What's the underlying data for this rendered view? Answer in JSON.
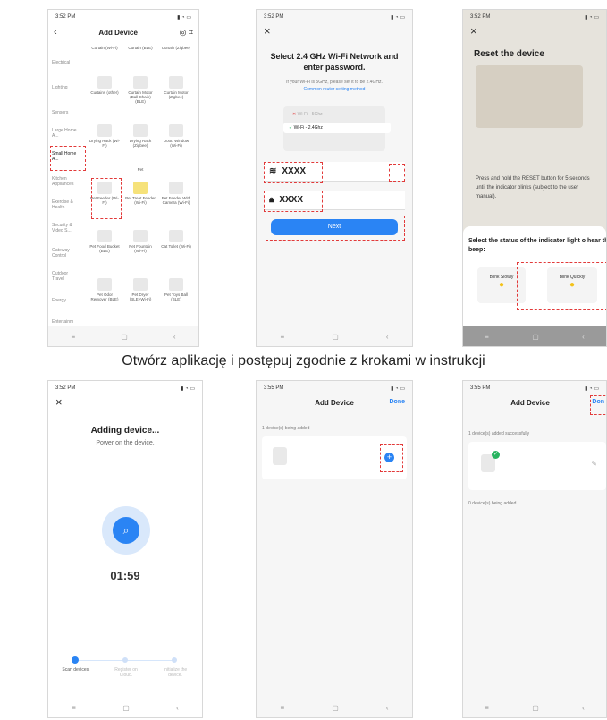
{
  "caption": "Otwórz aplikację i postępuj zgodnie z krokami w instrukcji",
  "screen1": {
    "time": "3:52 PM",
    "title": "Add Device",
    "categories": [
      "Electrical",
      "Lighting",
      "Sensors",
      "Large Home A...",
      "Small Home A...",
      "Kitchen Appliances",
      "Exercise & Health",
      "Security & Video S...",
      "Gateway Control",
      "Outdoor Travel",
      "Energy",
      "Entertainm"
    ],
    "devices_top": [
      "Curtain (Wi-Fi)",
      "Curtain (BLE)",
      "Curtain (Zigbee)",
      "Curtains (other)",
      "Curtain Motor (Ball Chain) (BLE)",
      "Curtain Motor (Zigbee)"
    ],
    "devices_mid": [
      "Drying Rack (Wi-Fi)",
      "Drying Rack (Zigbee)",
      "Door/ Window (Wi-Fi)"
    ],
    "pet_label": "Pet",
    "devices_pet": [
      "Pet Feeder (Wi-Fi)",
      "Pet Treat Feeder (Wi-Fi)",
      "Pet Feeder With Camera (Wi-Fi)",
      "Pet Food Bucket (BLE)",
      "Pet Fountain (Wi-Fi)",
      "Cat Toilet (Wi-Fi)",
      "Pet Odor Remover (BLE)",
      "Pet Dryer (BLE+Wi-Fi)",
      "Pet Toys Ball (BLE)"
    ]
  },
  "screen2": {
    "time": "3:52 PM",
    "heading": "Select 2.4 GHz Wi-Fi Network and enter password.",
    "sub": "If your Wi-Fi is 5GHz, please set it to be 2.4GHz.",
    "link": "Common router setting method",
    "wifi5": "Wi-Fi - 5Ghz",
    "wifi24": "Wi-Fi - 2.4Ghz",
    "ssid": "XXXX",
    "password": "XXXX",
    "next": "Next"
  },
  "screen3": {
    "time": "3:52 PM",
    "heading": "Reset the device",
    "desc": "Press and hold the RESET button for 5 seconds until the indicator blinks (subject to the user manual).",
    "question": "Select the status of the indicator light o hear the beep:",
    "opt1": "Blink Slowly",
    "opt2": "Blink Quickly"
  },
  "screen4": {
    "time": "3:52 PM",
    "heading": "Adding device...",
    "sub": "Power on the device.",
    "timer": "01:59",
    "steps": [
      "Scan devices.",
      "Register on Cloud.",
      "Initialize the device."
    ]
  },
  "screen5": {
    "time": "3:55 PM",
    "title": "Add Device",
    "done": "Done",
    "status": "1 device(s) being added"
  },
  "screen6": {
    "time": "3:55 PM",
    "title": "Add Device",
    "done": "Don",
    "added": "1 device(s) added successfully",
    "being": "0 device(s) being added"
  },
  "colors": {
    "accent": "#2a84f4",
    "red": "#e23a3a",
    "yellow": "#f3c21a"
  }
}
